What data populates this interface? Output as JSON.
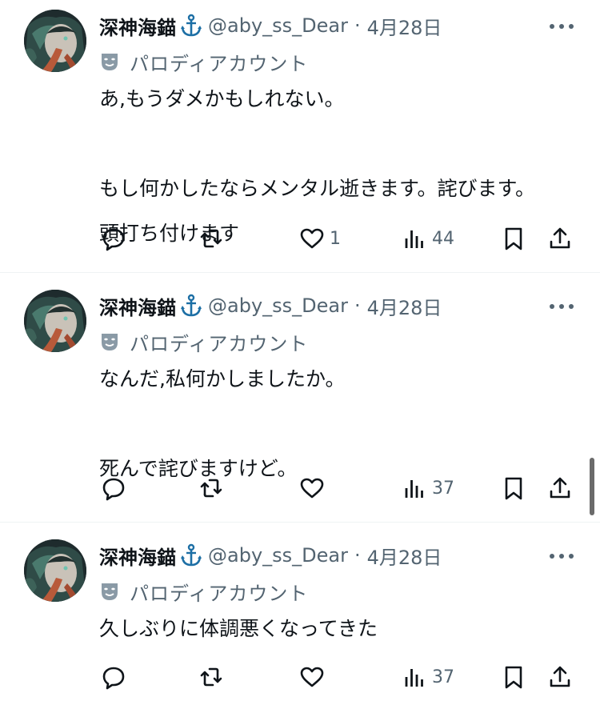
{
  "tweets": [
    {
      "name": "深神海錨",
      "handle": "@aby_ss_Dear",
      "separator": "·",
      "date": "4月28日",
      "parody_label": "パロディアカウント",
      "lines": [
        "あ,もうダメかもしれない。",
        "",
        "もし何かしたならメンタル逝きます。詫びます。",
        "頭打ち付けます"
      ],
      "reply_count": "",
      "retweet_count": "",
      "like_count": "1",
      "view_count": "44"
    },
    {
      "name": "深神海錨",
      "handle": "@aby_ss_Dear",
      "separator": "·",
      "date": "4月28日",
      "parody_label": "パロディアカウント",
      "lines": [
        "なんだ,私何かしましたか。",
        "",
        "死んで詫びますけど。"
      ],
      "reply_count": "",
      "retweet_count": "",
      "like_count": "",
      "view_count": "37"
    },
    {
      "name": "深神海錨",
      "handle": "@aby_ss_Dear",
      "separator": "·",
      "date": "4月28日",
      "parody_label": "パロディアカウント",
      "lines": [
        "久しぶりに体調悪くなってきた"
      ],
      "reply_count": "",
      "retweet_count": "",
      "like_count": "",
      "view_count": "37"
    }
  ],
  "icons": {
    "anchor": "anchor-icon",
    "mask": "parody-mask-icon",
    "more": "more-icon",
    "reply": "reply-icon",
    "retweet": "retweet-icon",
    "like": "like-icon",
    "views": "views-icon",
    "bookmark": "bookmark-icon",
    "share": "share-icon"
  },
  "colors": {
    "text": "#0f1419",
    "secondary": "#536471",
    "anchor": "#1d6fa5",
    "divider": "#eff3f4"
  }
}
